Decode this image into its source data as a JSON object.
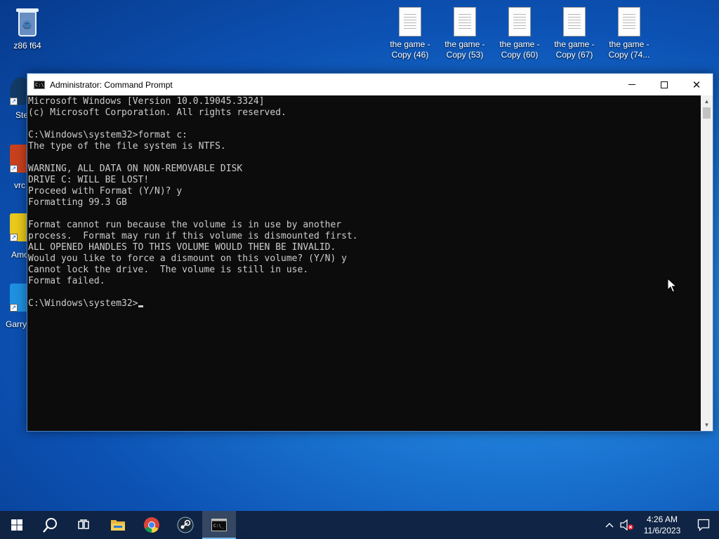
{
  "desktop": {
    "recycle_bin_label": "z86 f64",
    "files": [
      {
        "line1": "the game -",
        "line2": "Copy (46)"
      },
      {
        "line1": "the game -",
        "line2": "Copy (53)"
      },
      {
        "line1": "the game -",
        "line2": "Copy (60)"
      },
      {
        "line1": "the game -",
        "line2": "Copy (67)"
      },
      {
        "line1": "the game -",
        "line2": "Copy (74..."
      }
    ],
    "partial_labels": [
      "Ste",
      "vrc",
      "Amo",
      "Garry'"
    ]
  },
  "window": {
    "title": "Administrator: Command Prompt",
    "minimize_label": "Minimize",
    "maximize_label": "Maximize",
    "close_label": "✕"
  },
  "console": {
    "lines": [
      "Microsoft Windows [Version 10.0.19045.3324]",
      "(c) Microsoft Corporation. All rights reserved.",
      "",
      "C:\\Windows\\system32>format c:",
      "The type of the file system is NTFS.",
      "",
      "WARNING, ALL DATA ON NON-REMOVABLE DISK",
      "DRIVE C: WILL BE LOST!",
      "Proceed with Format (Y/N)? y",
      "Formatting 99.3 GB",
      "",
      "Format cannot run because the volume is in use by another",
      "process.  Format may run if this volume is dismounted first.",
      "ALL OPENED HANDLES TO THIS VOLUME WOULD THEN BE INVALID.",
      "Would you like to force a dismount on this volume? (Y/N) y",
      "Cannot lock the drive.  The volume is still in use.",
      "Format failed.",
      ""
    ],
    "prompt": "C:\\Windows\\system32>"
  },
  "taskbar": {
    "clock_time": "4:26 AM",
    "clock_date": "11/6/2023"
  },
  "icons": {
    "start": "windows-logo",
    "search": "search-icon",
    "task_view": "task-view-icon",
    "explorer": "folder-icon",
    "chrome": "chrome-icon",
    "steam": "steam-icon",
    "cmd": "cmd-icon",
    "tray_up": "chevron-up-icon",
    "volume": "volume-muted-icon",
    "notifications": "notification-icon"
  }
}
